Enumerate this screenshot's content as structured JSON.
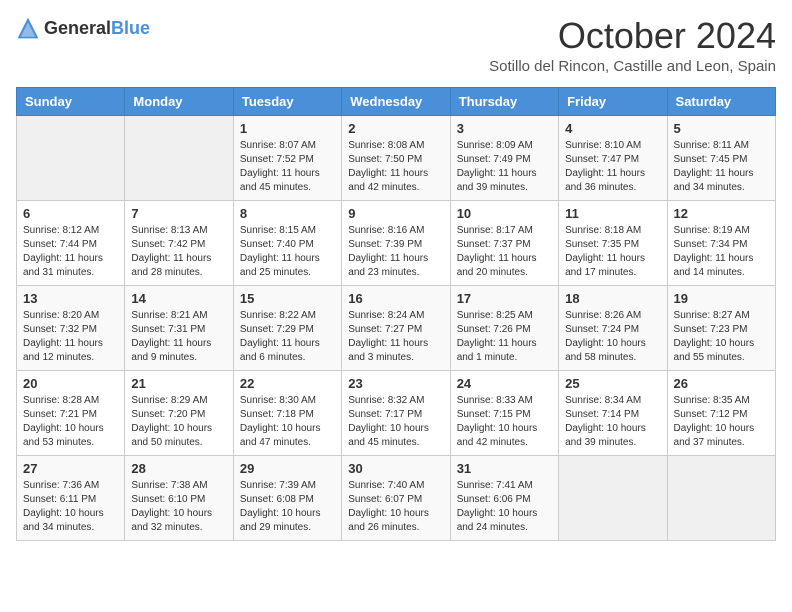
{
  "header": {
    "logo_general": "General",
    "logo_blue": "Blue",
    "month": "October 2024",
    "location": "Sotillo del Rincon, Castille and Leon, Spain"
  },
  "days_of_week": [
    "Sunday",
    "Monday",
    "Tuesday",
    "Wednesday",
    "Thursday",
    "Friday",
    "Saturday"
  ],
  "weeks": [
    [
      {
        "day": "",
        "info": ""
      },
      {
        "day": "",
        "info": ""
      },
      {
        "day": "1",
        "info": "Sunrise: 8:07 AM\nSunset: 7:52 PM\nDaylight: 11 hours and 45 minutes."
      },
      {
        "day": "2",
        "info": "Sunrise: 8:08 AM\nSunset: 7:50 PM\nDaylight: 11 hours and 42 minutes."
      },
      {
        "day": "3",
        "info": "Sunrise: 8:09 AM\nSunset: 7:49 PM\nDaylight: 11 hours and 39 minutes."
      },
      {
        "day": "4",
        "info": "Sunrise: 8:10 AM\nSunset: 7:47 PM\nDaylight: 11 hours and 36 minutes."
      },
      {
        "day": "5",
        "info": "Sunrise: 8:11 AM\nSunset: 7:45 PM\nDaylight: 11 hours and 34 minutes."
      }
    ],
    [
      {
        "day": "6",
        "info": "Sunrise: 8:12 AM\nSunset: 7:44 PM\nDaylight: 11 hours and 31 minutes."
      },
      {
        "day": "7",
        "info": "Sunrise: 8:13 AM\nSunset: 7:42 PM\nDaylight: 11 hours and 28 minutes."
      },
      {
        "day": "8",
        "info": "Sunrise: 8:15 AM\nSunset: 7:40 PM\nDaylight: 11 hours and 25 minutes."
      },
      {
        "day": "9",
        "info": "Sunrise: 8:16 AM\nSunset: 7:39 PM\nDaylight: 11 hours and 23 minutes."
      },
      {
        "day": "10",
        "info": "Sunrise: 8:17 AM\nSunset: 7:37 PM\nDaylight: 11 hours and 20 minutes."
      },
      {
        "day": "11",
        "info": "Sunrise: 8:18 AM\nSunset: 7:35 PM\nDaylight: 11 hours and 17 minutes."
      },
      {
        "day": "12",
        "info": "Sunrise: 8:19 AM\nSunset: 7:34 PM\nDaylight: 11 hours and 14 minutes."
      }
    ],
    [
      {
        "day": "13",
        "info": "Sunrise: 8:20 AM\nSunset: 7:32 PM\nDaylight: 11 hours and 12 minutes."
      },
      {
        "day": "14",
        "info": "Sunrise: 8:21 AM\nSunset: 7:31 PM\nDaylight: 11 hours and 9 minutes."
      },
      {
        "day": "15",
        "info": "Sunrise: 8:22 AM\nSunset: 7:29 PM\nDaylight: 11 hours and 6 minutes."
      },
      {
        "day": "16",
        "info": "Sunrise: 8:24 AM\nSunset: 7:27 PM\nDaylight: 11 hours and 3 minutes."
      },
      {
        "day": "17",
        "info": "Sunrise: 8:25 AM\nSunset: 7:26 PM\nDaylight: 11 hours and 1 minute."
      },
      {
        "day": "18",
        "info": "Sunrise: 8:26 AM\nSunset: 7:24 PM\nDaylight: 10 hours and 58 minutes."
      },
      {
        "day": "19",
        "info": "Sunrise: 8:27 AM\nSunset: 7:23 PM\nDaylight: 10 hours and 55 minutes."
      }
    ],
    [
      {
        "day": "20",
        "info": "Sunrise: 8:28 AM\nSunset: 7:21 PM\nDaylight: 10 hours and 53 minutes."
      },
      {
        "day": "21",
        "info": "Sunrise: 8:29 AM\nSunset: 7:20 PM\nDaylight: 10 hours and 50 minutes."
      },
      {
        "day": "22",
        "info": "Sunrise: 8:30 AM\nSunset: 7:18 PM\nDaylight: 10 hours and 47 minutes."
      },
      {
        "day": "23",
        "info": "Sunrise: 8:32 AM\nSunset: 7:17 PM\nDaylight: 10 hours and 45 minutes."
      },
      {
        "day": "24",
        "info": "Sunrise: 8:33 AM\nSunset: 7:15 PM\nDaylight: 10 hours and 42 minutes."
      },
      {
        "day": "25",
        "info": "Sunrise: 8:34 AM\nSunset: 7:14 PM\nDaylight: 10 hours and 39 minutes."
      },
      {
        "day": "26",
        "info": "Sunrise: 8:35 AM\nSunset: 7:12 PM\nDaylight: 10 hours and 37 minutes."
      }
    ],
    [
      {
        "day": "27",
        "info": "Sunrise: 7:36 AM\nSunset: 6:11 PM\nDaylight: 10 hours and 34 minutes."
      },
      {
        "day": "28",
        "info": "Sunrise: 7:38 AM\nSunset: 6:10 PM\nDaylight: 10 hours and 32 minutes."
      },
      {
        "day": "29",
        "info": "Sunrise: 7:39 AM\nSunset: 6:08 PM\nDaylight: 10 hours and 29 minutes."
      },
      {
        "day": "30",
        "info": "Sunrise: 7:40 AM\nSunset: 6:07 PM\nDaylight: 10 hours and 26 minutes."
      },
      {
        "day": "31",
        "info": "Sunrise: 7:41 AM\nSunset: 6:06 PM\nDaylight: 10 hours and 24 minutes."
      },
      {
        "day": "",
        "info": ""
      },
      {
        "day": "",
        "info": ""
      }
    ]
  ]
}
